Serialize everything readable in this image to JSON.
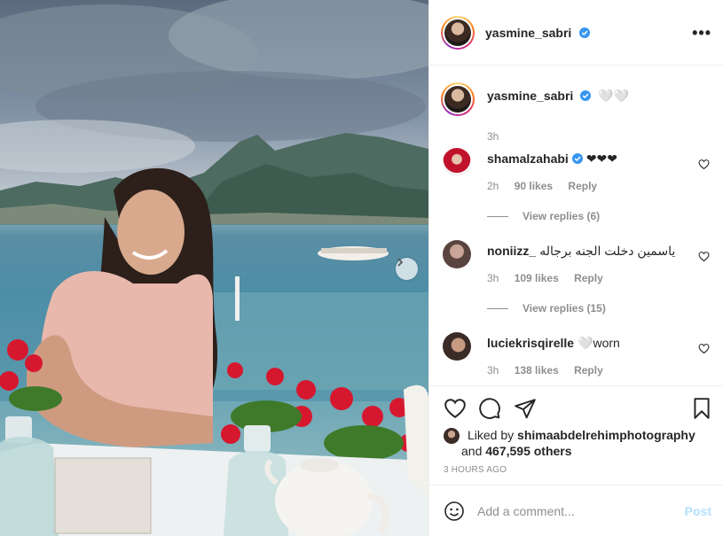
{
  "post": {
    "username": "yasmine_sabri",
    "verified": true
  },
  "caption": {
    "username": "yasmine_sabri",
    "text": "🤍🤍",
    "time": "3h"
  },
  "comments": [
    {
      "username": "shamalzahabi",
      "verified": true,
      "text": "❤❤❤",
      "time": "2h",
      "likes": "90 likes",
      "reply": "Reply",
      "view_replies": "View replies (6)"
    },
    {
      "username": "noniizz_",
      "verified": false,
      "text": "ياسمين دخلت الجنه برجاله",
      "time": "3h",
      "likes": "109 likes",
      "reply": "Reply",
      "view_replies": "View replies (15)"
    },
    {
      "username": "luciekrisqirelle",
      "verified": false,
      "text": "🤍worn",
      "time": "3h",
      "likes": "138 likes",
      "reply": "Reply"
    }
  ],
  "likes": {
    "prefix": "Liked by",
    "liker": "shimaabdelrehimphotography",
    "and": "and",
    "count": "467,595 others"
  },
  "time_ago": "3 HOURS AGO",
  "add_comment": {
    "placeholder": "Add a comment...",
    "post_label": "Post"
  },
  "icons": {
    "like": "heart-icon",
    "comment": "comment-bubble-icon",
    "share": "paper-plane-icon",
    "save": "bookmark-icon",
    "emoji": "smiley-icon",
    "more": "more-options-icon",
    "next": "chevron-right-icon",
    "verified": "verified-badge-icon"
  },
  "colors": {
    "verified": "#3897f0",
    "post_disabled": "#b2dffc",
    "muted_text": "#8e8e8e"
  }
}
